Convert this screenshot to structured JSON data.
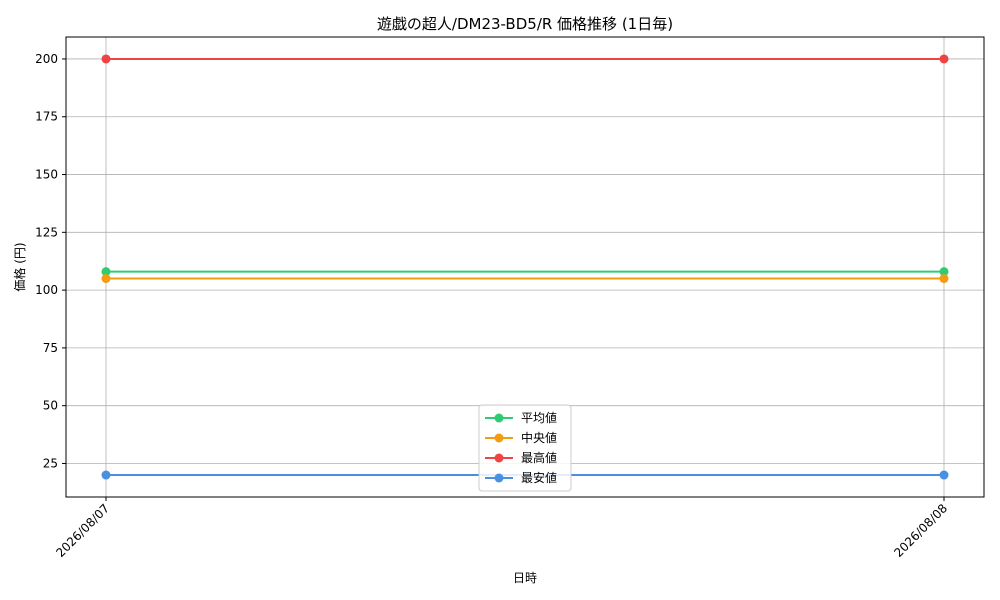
{
  "chart_data": {
    "type": "line",
    "title": "遊戯の超人/DM23-BD5/R 価格推移 (1日毎)",
    "xlabel": "日時",
    "ylabel": "価格 (円)",
    "x": [
      "2026/08/07",
      "2026/08/08"
    ],
    "ylim": [
      10.5,
      209.5
    ],
    "yticks": [
      25,
      50,
      75,
      100,
      125,
      150,
      175,
      200
    ],
    "grid": true,
    "legend_position": "bottom-center",
    "series": [
      {
        "name": "平均値",
        "values": [
          108,
          108
        ],
        "color": "#2ecc71"
      },
      {
        "name": "中央値",
        "values": [
          105,
          105
        ],
        "color": "#f39c12"
      },
      {
        "name": "最高値",
        "values": [
          200,
          200
        ],
        "color": "#ef4444"
      },
      {
        "name": "最安値",
        "values": [
          20,
          20
        ],
        "color": "#4a90e2"
      }
    ]
  }
}
